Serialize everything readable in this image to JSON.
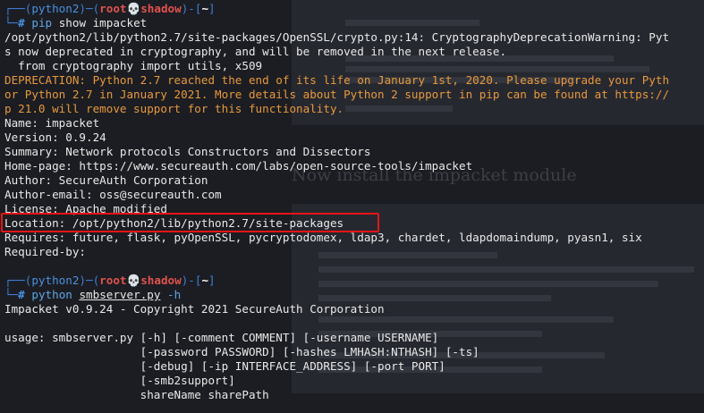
{
  "prompt": {
    "env": "python2",
    "user": "root",
    "skull": "💀",
    "host": "shadow",
    "path": "~",
    "hash": "#"
  },
  "commands": {
    "pip_cmd": "pip",
    "pip_args": " show impacket",
    "python_cmd": "python",
    "python_script": "smbserver.py",
    "python_flag": "-h"
  },
  "output": {
    "warning_line1": "/opt/python2/lib/python2.7/site-packages/OpenSSL/crypto.py:14: CryptographyDeprecationWarning: Pyt",
    "warning_line2": "s now deprecated in cryptography, and will be removed in the next release.",
    "warning_line3": "  from cryptography import utils, x509",
    "deprecation_line1": "DEPRECATION: Python 2.7 reached the end of its life on January 1st, 2020. Please upgrade your Pyth",
    "deprecation_line2": "or Python 2.7 in January 2021. More details about Python 2 support in pip can be found at https://",
    "deprecation_line3": "p 21.0 will remove support for this functionality.",
    "name": "Name: impacket",
    "version": "Version: 0.9.24",
    "summary": "Summary: Network protocols Constructors and Dissectors",
    "homepage": "Home-page: https://www.secureauth.com/labs/open-source-tools/impacket",
    "author": "Author: SecureAuth Corporation",
    "author_email": "Author-email: oss@secureauth.com",
    "license": "License: Apache modified",
    "location": "Location: /opt/python2/lib/python2.7/site-packages",
    "requires": "Requires: future, flask, pyOpenSSL, pycryptodomex, ldap3, chardet, ldapdomaindump, pyasn1, six",
    "required_by": "Required-by:",
    "banner": "Impacket v0.9.24 - Copyright 2021 SecureAuth Corporation",
    "usage1": "usage: smbserver.py [-h] [-comment COMMENT] [-username USERNAME]",
    "usage2": "                    [-password PASSWORD] [-hashes LMHASH:NTHASH] [-ts]",
    "usage3": "                    [-debug] [-ip INTERFACE_ADDRESS] [-port PORT]",
    "usage4": "                    [-smb2support]",
    "usage5": "                    shareName sharePath"
  },
  "background": {
    "heading": "Now install the impacket module"
  },
  "colors": {
    "background": "#1b1d22",
    "highlight_box": "#e81416",
    "deprecation_text": "#e8993a",
    "prompt_frame": "#3f7ed6"
  }
}
